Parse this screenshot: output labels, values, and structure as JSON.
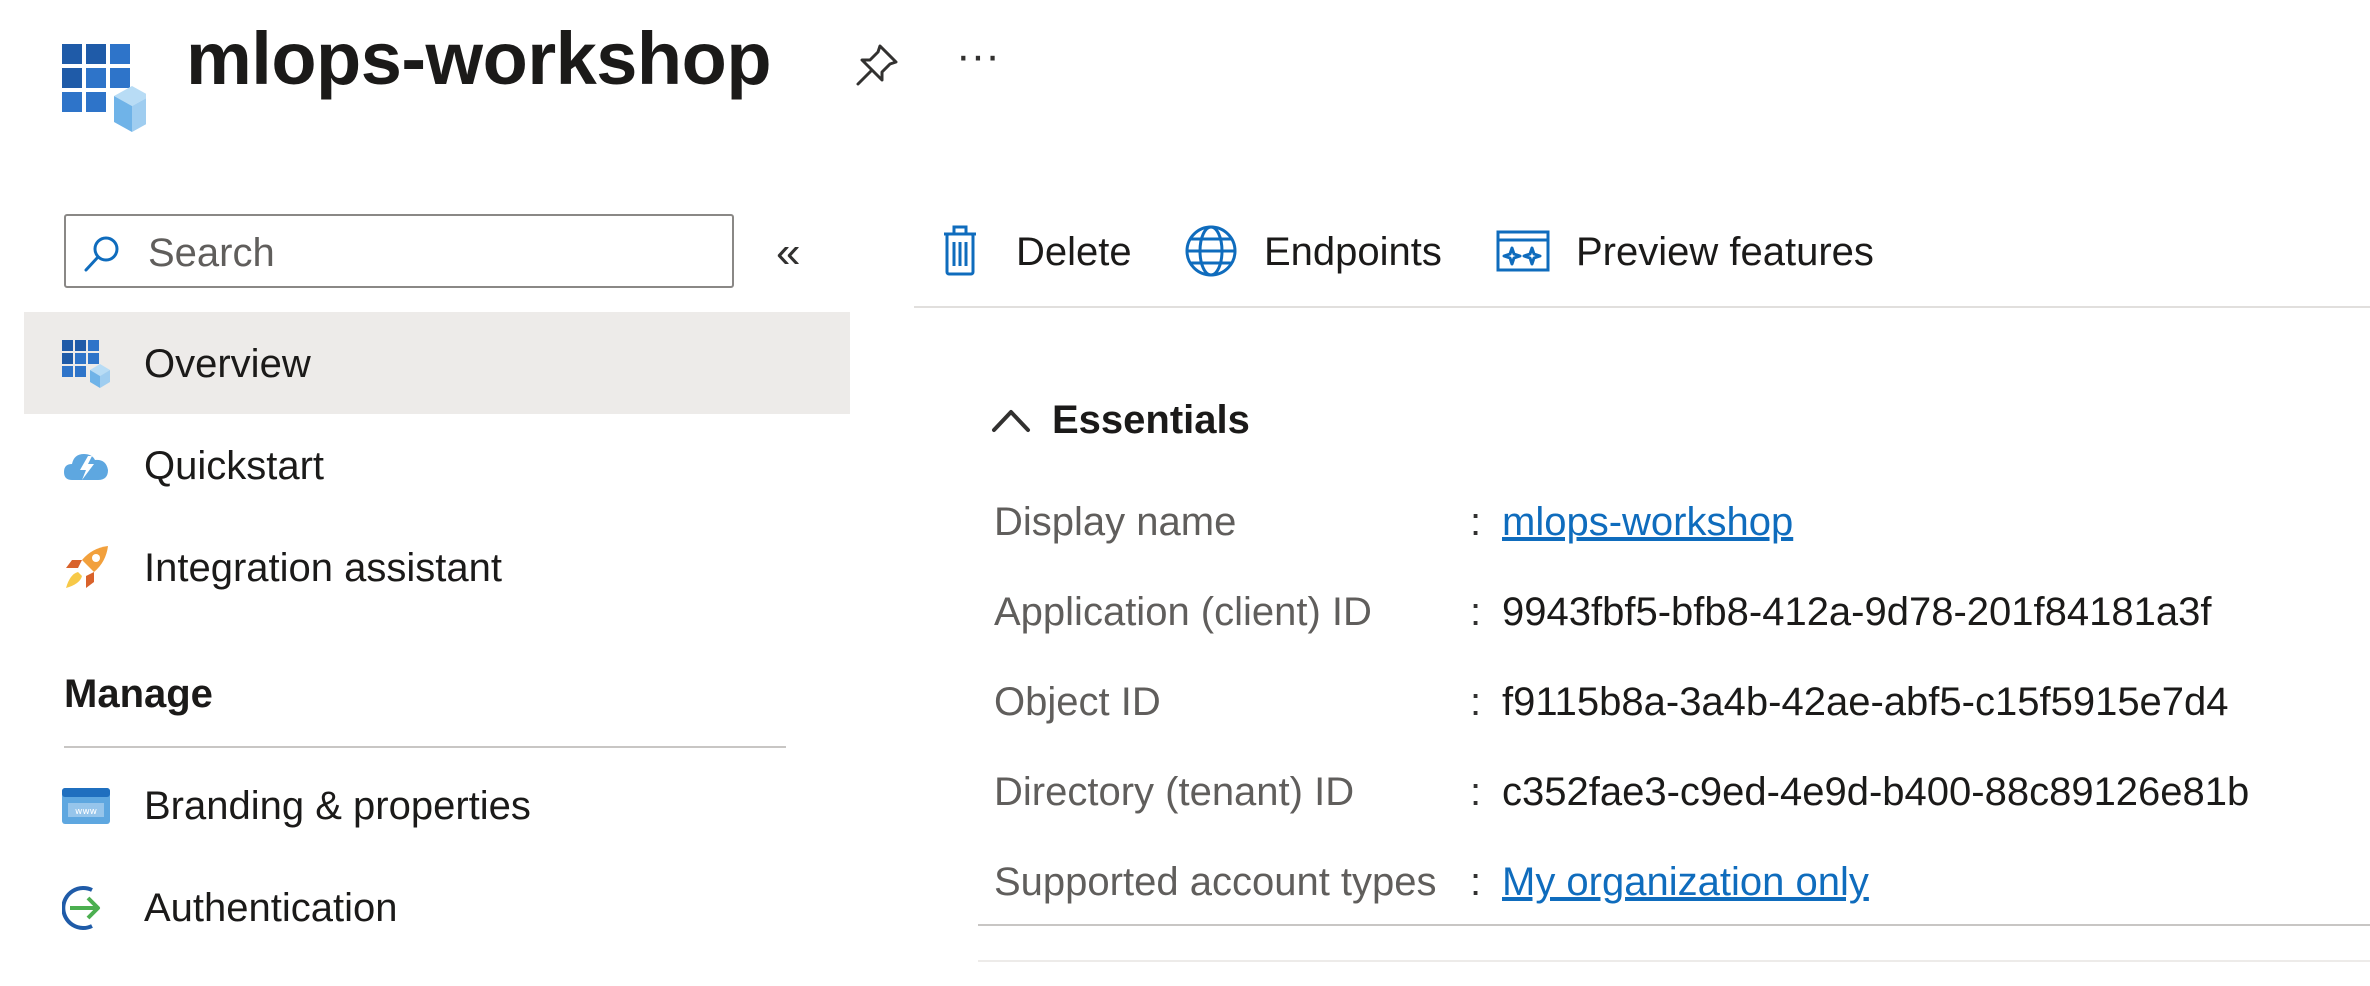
{
  "header": {
    "title": "mlops-workshop",
    "more_label": "···",
    "icons": {
      "app": "app-registration-icon",
      "pin": "pin-icon"
    }
  },
  "nav": {
    "search_placeholder": "Search",
    "collapse_label": "«",
    "items": [
      {
        "label": "Overview",
        "icon": "overview-grid-icon",
        "active": true
      },
      {
        "label": "Quickstart",
        "icon": "quickstart-cloud-icon",
        "active": false
      },
      {
        "label": "Integration assistant",
        "icon": "rocket-icon",
        "active": false
      }
    ],
    "manage_heading": "Manage",
    "manage_items": [
      {
        "label": "Branding & properties",
        "icon": "branding-www-icon"
      },
      {
        "label": "Authentication",
        "icon": "authentication-arrow-icon"
      }
    ]
  },
  "toolbar": {
    "delete_label": "Delete",
    "endpoints_label": "Endpoints",
    "preview_label": "Preview features"
  },
  "essentials": {
    "title": "Essentials",
    "rows": [
      {
        "label": "Display name",
        "value": "mlops-workshop",
        "is_link": true
      },
      {
        "label": "Application (client) ID",
        "value": "9943fbf5-bfb8-412a-9d78-201f84181a3f",
        "is_link": false
      },
      {
        "label": "Object ID",
        "value": "f9115b8a-3a4b-42ae-abf5-c15f5915e7d4",
        "is_link": false
      },
      {
        "label": "Directory (tenant) ID",
        "value": "c352fae3-c9ed-4e9d-b400-88c89126e81b",
        "is_link": false
      },
      {
        "label": "Supported account types",
        "value": "My organization only",
        "is_link": true
      }
    ],
    "colon": ":"
  },
  "colors": {
    "accent": "#0f6cbd",
    "active_bg": "#edebe9",
    "text": "#323130"
  }
}
